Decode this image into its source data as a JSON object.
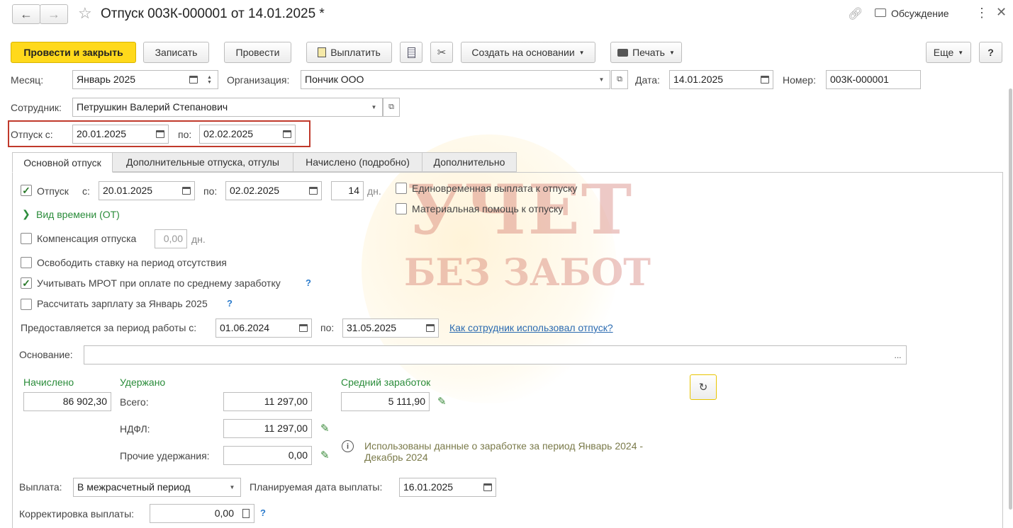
{
  "window": {
    "title": "Отпуск 003К-000001 от 14.01.2025 *",
    "discussion": "Обсуждение"
  },
  "toolbar": {
    "post_close": "Провести и закрыть",
    "save": "Записать",
    "post": "Провести",
    "pay": "Выплатить",
    "create_based": "Создать на основании",
    "print": "Печать",
    "more": "Еще",
    "help": "?"
  },
  "header": {
    "month_label": "Месяц:",
    "month_value": "Январь 2025",
    "org_label": "Организация:",
    "org_value": "Пончик ООО",
    "date_label": "Дата:",
    "date_value": "14.01.2025",
    "number_label": "Номер:",
    "number_value": "003К-000001",
    "employee_label": "Сотрудник:",
    "employee_value": "Петрушкин Валерий Степанович",
    "vac_from_label": "Отпуск с:",
    "vac_from_value": "20.01.2025",
    "vac_to_label": "по:",
    "vac_to_value": "02.02.2025"
  },
  "tabs": [
    "Основной отпуск",
    "Дополнительные отпуска, отгулы",
    "Начислено (подробно)",
    "Дополнительно"
  ],
  "main": {
    "vacation_cb_label": "Отпуск",
    "from_label": "с:",
    "from_value": "20.01.2025",
    "to_label": "по:",
    "to_value": "02.02.2025",
    "days_value": "14",
    "days_unit": "дн.",
    "lump_sum_label": "Единовременная выплата к отпуску",
    "material_aid_label": "Материальная помощь к отпуску",
    "time_type_label": "Вид времени (ОТ)",
    "compensation_label": "Компенсация отпуска",
    "compensation_value": "0,00",
    "compensation_unit": "дн.",
    "free_rate_label": "Освободить ставку на период отсутствия",
    "mrot_label": "Учитывать МРОТ при оплате по среднему заработку",
    "calc_salary_label": "Рассчитать зарплату за Январь 2025",
    "help_q": "?",
    "period_label": "Предоставляется за период работы с:",
    "period_from": "01.06.2024",
    "period_to_label": "по:",
    "period_to": "31.05.2025",
    "usage_link": "Как сотрудник использовал отпуск?",
    "basis_label": "Основание:",
    "basis_value": "",
    "basis_btn": "...",
    "accrued_label": "Начислено",
    "accrued_value": "86 902,30",
    "withheld_label": "Удержано",
    "total_label": "Всего:",
    "total_value": "11 297,00",
    "ndfl_label": "НДФЛ:",
    "ndfl_value": "11 297,00",
    "other_label": "Прочие удержания:",
    "other_value": "0,00",
    "avg_label": "Средний заработок",
    "avg_value": "5 111,90",
    "info_text_1": "Использованы данные о заработке за период Январь 2024 -",
    "info_text_2": "Декабрь 2024",
    "payout_label": "Выплата:",
    "payout_value": "В межрасчетный период",
    "planned_date_label": "Планируемая дата выплаты:",
    "planned_date_value": "16.01.2025",
    "correction_label": "Корректировка выплаты:",
    "correction_value": "0,00"
  },
  "watermark": {
    "line1": "УЧЕТ",
    "line2": "БЕЗ ЗАБОТ"
  },
  "colors": {
    "primary": "#ffd91b",
    "green": "#2a8c3a",
    "highlight": "#c0392b",
    "link": "#2a6ab0"
  }
}
